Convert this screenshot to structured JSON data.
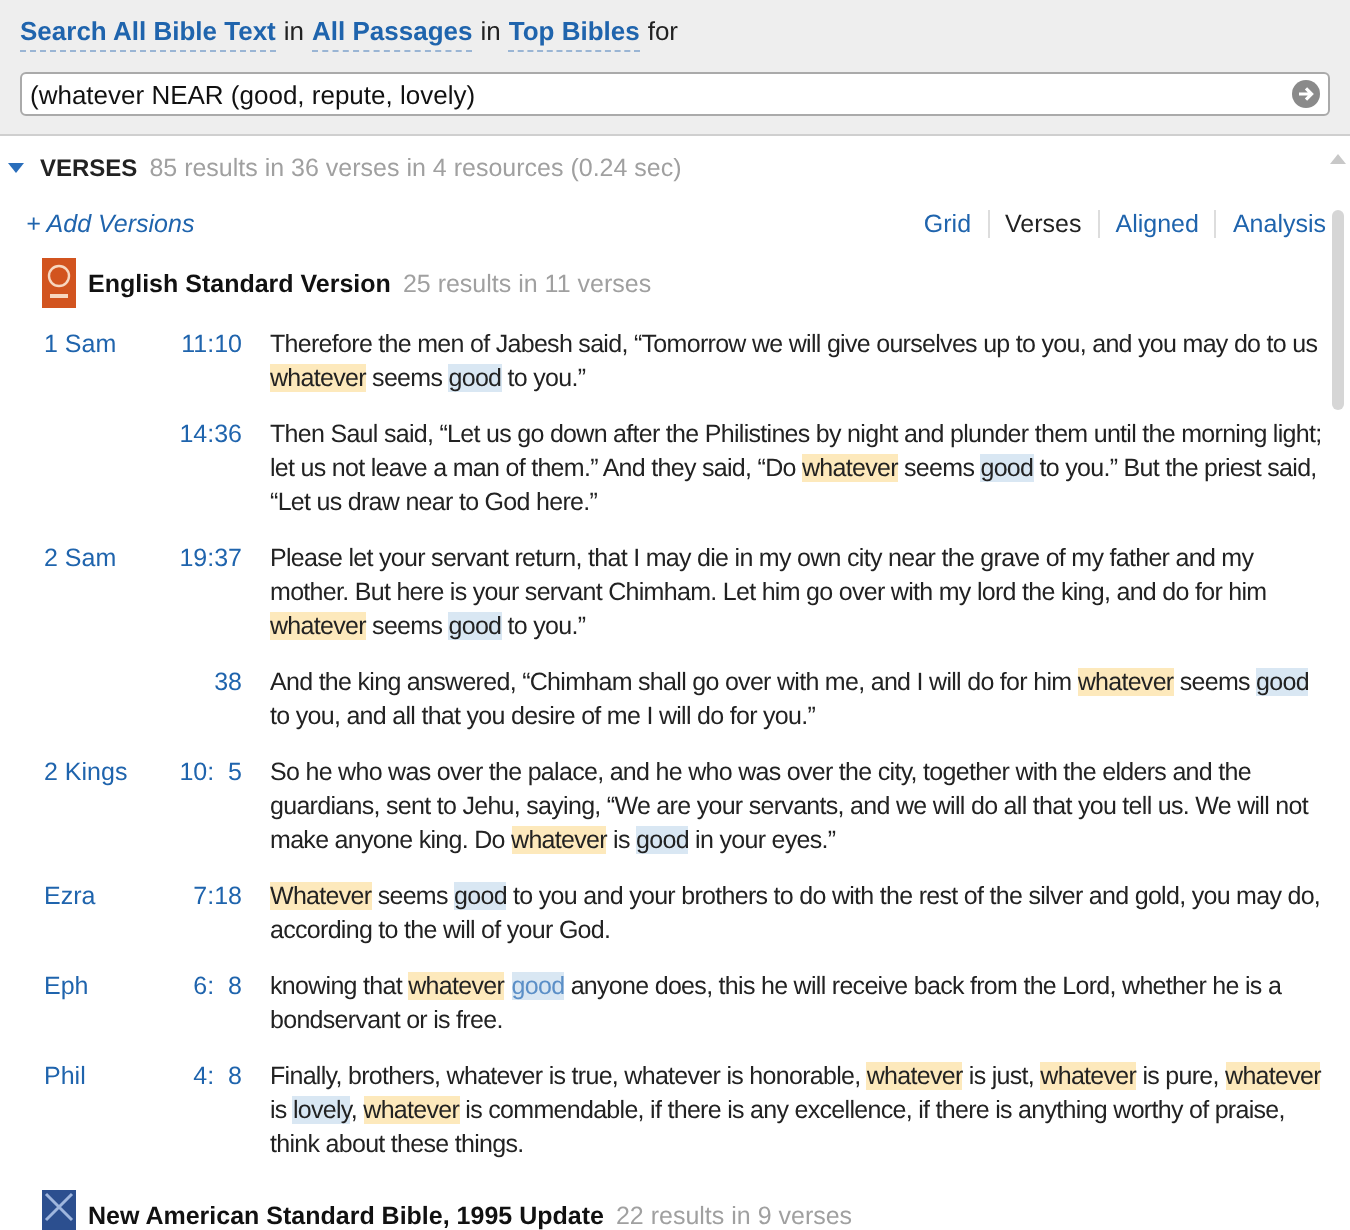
{
  "search": {
    "parts": [
      {
        "text": "Search All Bible Text",
        "kind": "dropdown"
      },
      {
        "text": "in",
        "kind": "plain"
      },
      {
        "text": "All Passages",
        "kind": "dropdown"
      },
      {
        "text": "in",
        "kind": "plain"
      },
      {
        "text": "Top Bibles",
        "kind": "dropdown"
      },
      {
        "text": "for",
        "kind": "plain"
      }
    ],
    "query": "(whatever NEAR (good, repute, lovely)"
  },
  "section": {
    "title": "VERSES",
    "expanded": true,
    "summary": "85 results in 36 verses in 4 resources (0.24 sec)"
  },
  "add_versions": "+ Add Versions",
  "views": [
    {
      "label": "Grid",
      "selected": false
    },
    {
      "label": "Verses",
      "selected": true
    },
    {
      "label": "Aligned",
      "selected": false
    },
    {
      "label": "Analysis",
      "selected": false
    }
  ],
  "resources": [
    {
      "name": "English Standard Version",
      "count": "25 results in 11 verses",
      "verses": [
        {
          "book": "1 Sam",
          "ref": "11:10",
          "parts": [
            {
              "text": "Therefore the men of Jabesh said, “Tomorrow we will give ourselves up to you, and you may do to us ",
              "kind": "plain"
            },
            {
              "text": "whatever",
              "kind": "match"
            },
            {
              "text": " seems ",
              "kind": "plain"
            },
            {
              "text": "good",
              "kind": "near"
            },
            {
              "text": " to you.”",
              "kind": "plain"
            }
          ]
        },
        {
          "ref": "14:36",
          "parts": [
            {
              "text": "Then Saul said, “Let us go down after the Philistines by night and plunder them until the morning light; let us not leave a man of them.” And they said, “Do ",
              "kind": "plain"
            },
            {
              "text": "whatever",
              "kind": "match"
            },
            {
              "text": " seems ",
              "kind": "plain"
            },
            {
              "text": "good",
              "kind": "near"
            },
            {
              "text": " to you.” But the priest said, “Let us draw near to God here.”",
              "kind": "plain"
            }
          ]
        },
        {
          "book": "2 Sam",
          "ref": "19:37",
          "parts": [
            {
              "text": "Please let your servant return, that I may die in my own city near the grave of my father and my mother. But here is your servant Chimham. Let him go over with my lord the king, and do for him ",
              "kind": "plain"
            },
            {
              "text": "whatever",
              "kind": "match"
            },
            {
              "text": " seems ",
              "kind": "plain"
            },
            {
              "text": "good",
              "kind": "near"
            },
            {
              "text": " to you.”",
              "kind": "plain"
            }
          ]
        },
        {
          "ref": "38",
          "parts": [
            {
              "text": "And the king answered, “Chimham shall go over with me, and I will do for him ",
              "kind": "plain"
            },
            {
              "text": "whatever",
              "kind": "match"
            },
            {
              "text": " seems ",
              "kind": "plain"
            },
            {
              "text": "good",
              "kind": "near"
            },
            {
              "text": " to you, and all that you desire of me I will do for you.”",
              "kind": "plain"
            }
          ]
        },
        {
          "book": "2 Kings",
          "ref": "10:  5",
          "parts": [
            {
              "text": "So he who was over the palace, and he who was over the city, together with the elders and the guardians, sent to Jehu, saying, “We are your servants, and we will do all that you tell us. We will not make anyone king. Do ",
              "kind": "plain"
            },
            {
              "text": "whatever",
              "kind": "match"
            },
            {
              "text": " is ",
              "kind": "plain"
            },
            {
              "text": "good",
              "kind": "near"
            },
            {
              "text": " in your eyes.”",
              "kind": "plain"
            }
          ]
        },
        {
          "book": "Ezra",
          "ref": "7:18",
          "parts": [
            {
              "text": "Whatever",
              "kind": "match"
            },
            {
              "text": " seems ",
              "kind": "plain"
            },
            {
              "text": "good",
              "kind": "near"
            },
            {
              "text": " to you and your brothers to do with the rest of the silver and gold, you may do, according to the will of your God.",
              "kind": "plain"
            }
          ]
        },
        {
          "book": "Eph",
          "ref": "6:  8",
          "parts": [
            {
              "text": "knowing that ",
              "kind": "plain"
            },
            {
              "text": "whatever",
              "kind": "match"
            },
            {
              "text": "good",
              "kind": "link"
            },
            {
              "text": " anyone does, this he will receive back from the Lord, whether he is a bondservant or is free.",
              "kind": "plain"
            }
          ]
        },
        {
          "book": "Phil",
          "ref": "4:  8",
          "parts": [
            {
              "text": "Finally, brothers, whatever is true, whatever is honorable, ",
              "kind": "plain"
            },
            {
              "text": "whatever",
              "kind": "match"
            },
            {
              "text": " is just, ",
              "kind": "plain"
            },
            {
              "text": "whatever",
              "kind": "match"
            },
            {
              "text": " is pure, ",
              "kind": "plain"
            },
            {
              "text": "whatever",
              "kind": "match"
            },
            {
              "text": " is ",
              "kind": "plain"
            },
            {
              "text": "lovely",
              "kind": "near"
            },
            {
              "text": ", ",
              "kind": "plain"
            },
            {
              "text": "whatever",
              "kind": "match"
            },
            {
              "text": " is commendable, if there is any excellence, if there is anything worthy of praise, think about these things.",
              "kind": "plain"
            }
          ]
        }
      ]
    },
    {
      "name": "New American Standard Bible, 1995 Update",
      "count": "22 results in 9 verses"
    }
  ]
}
